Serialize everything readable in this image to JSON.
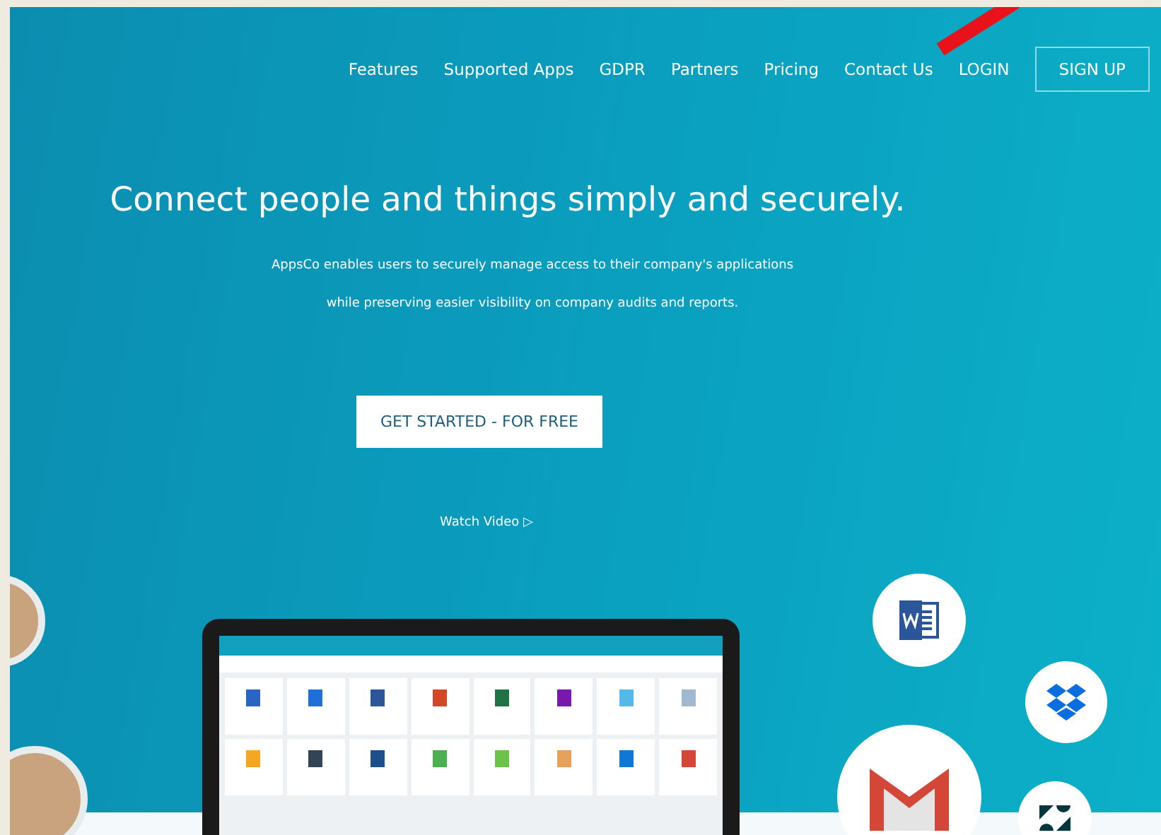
{
  "nav": {
    "links": [
      "Features",
      "Supported Apps",
      "GDPR",
      "Partners",
      "Pricing",
      "Contact Us"
    ],
    "login": "LOGIN",
    "signup": "SIGN UP"
  },
  "hero": {
    "headline": "Connect people and things simply and securely.",
    "subtitle_lines": [
      "AppsCo enables users to securely manage access to their company's applications",
      "while preserving easier visibility on company audits and reports."
    ],
    "cta": "GET STARTED - FOR FREE",
    "video_link": "Watch Video ▷"
  }
}
